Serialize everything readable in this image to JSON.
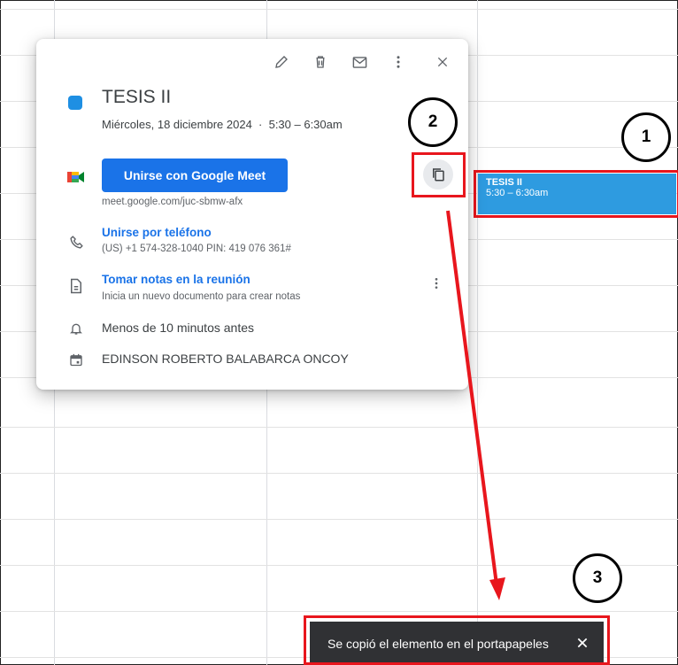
{
  "event_chip": {
    "title": "TESIS II",
    "time": "5:30 – 6:30am",
    "color": "#2e9be0"
  },
  "popup": {
    "toolbar": [
      "edit-icon",
      "delete-icon",
      "email-icon",
      "more-vert-icon",
      "close-icon"
    ],
    "title": "TESIS II",
    "date_line": "Miércoles, 18 diciembre 2024  ·  5:30 – 6:30am",
    "meet_button": "Unirse con Google Meet",
    "meet_url": "meet.google.com/juc-sbmw-afx",
    "phone_link": "Unirse por teléfono",
    "phone_detail": "(US) +1 574-328-1040 PIN: 419 076 361#",
    "notes_link": "Tomar notas en la reunión",
    "notes_detail": "Inicia un nuevo documento para crear notas",
    "reminder": "Menos de 10 minutos antes",
    "organizer": "EDINSON ROBERTO BALABARCA ONCOY",
    "accent_color": "#1a73e8"
  },
  "toast": {
    "message": "Se copió el elemento en el portapapeles"
  },
  "annotations": {
    "step1": "1",
    "step2": "2",
    "step3": "3",
    "color": "#e8161d"
  }
}
